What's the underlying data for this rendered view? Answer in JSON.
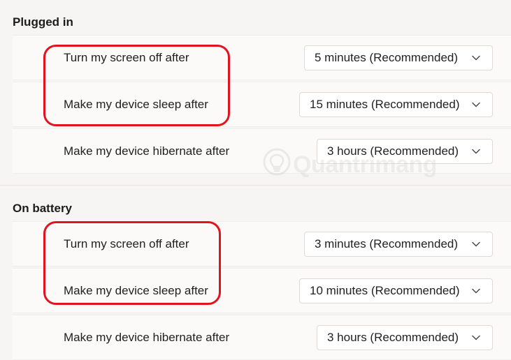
{
  "sections": [
    {
      "title": "Plugged in",
      "rows": [
        {
          "label": "Turn my screen off after",
          "value": "5 minutes (Recommended)"
        },
        {
          "label": "Make my device sleep after",
          "value": "15 minutes (Recommended)"
        },
        {
          "label": "Make my device hibernate after",
          "value": "3 hours (Recommended)"
        }
      ]
    },
    {
      "title": "On battery",
      "rows": [
        {
          "label": "Turn my screen off after",
          "value": "3 minutes (Recommended)"
        },
        {
          "label": "Make my device sleep after",
          "value": "10 minutes (Recommended)"
        },
        {
          "label": "Make my device hibernate after",
          "value": "3 hours (Recommended)"
        }
      ]
    }
  ],
  "watermark": {
    "text": "Quantrimang"
  },
  "colors": {
    "highlight": "#e1131f",
    "background": "#f6f5f3",
    "row_background": "#fbfaf8"
  },
  "icons": {
    "dropdown": "chevron-down-icon",
    "watermark": "lightbulb-icon"
  }
}
